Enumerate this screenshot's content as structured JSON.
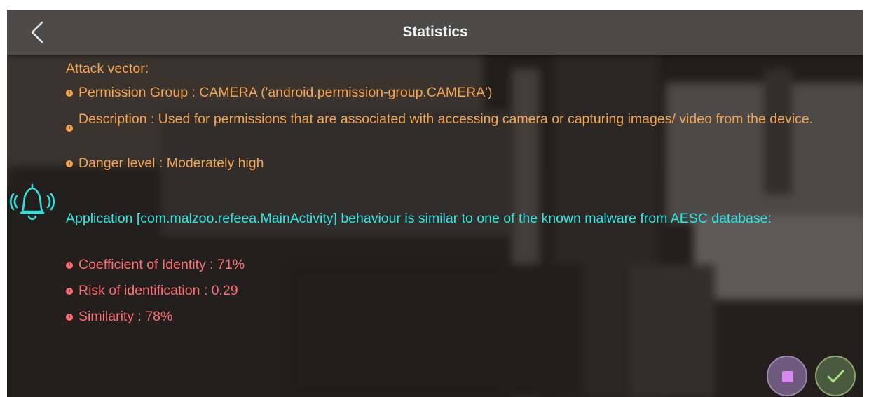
{
  "appbar": {
    "title": "Statistics"
  },
  "attack": {
    "heading": "Attack vector:",
    "items": [
      "Permission Group : CAMERA ('android.permission-group.CAMERA')",
      "Description : Used for permissions that are associated with accessing camera or capturing images/ video from the device.",
      "Danger level : Moderately high"
    ]
  },
  "behaviour": {
    "message": "Application [com.malzoo.refeea.MainActivity] behaviour is similar to one of the known malware from AESC database:",
    "items": [
      "Coefficient of Identity : 71%",
      "Risk of identification : 0.29",
      "Similarity : 78%"
    ]
  },
  "icons": {
    "back": "back-arrow-icon",
    "alarm": "ringing-bell-icon",
    "stop": "stop-square-icon",
    "confirm": "checkmark-icon"
  },
  "colors": {
    "appbar": "#4b4a49",
    "attack_text": "#f5a552",
    "behaviour_text": "#33e6e3",
    "metric_text": "#ff6f78",
    "stop_button": "#6e5a7e",
    "confirm_button": "#4a5a3e"
  }
}
